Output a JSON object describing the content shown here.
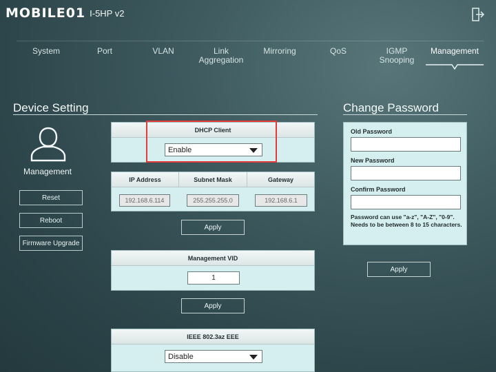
{
  "header": {
    "brand_logo": "MOBILE01",
    "model": "I-5HP v2",
    "logout_icon": "logout-icon"
  },
  "nav": {
    "tabs": [
      {
        "label": "System"
      },
      {
        "label": "Port"
      },
      {
        "label": "VLAN"
      },
      {
        "label": "Link\nAggregation"
      },
      {
        "label": "Mirroring"
      },
      {
        "label": "QoS"
      },
      {
        "label": "IGMP\nSnooping"
      },
      {
        "label": "Management",
        "active": true
      }
    ]
  },
  "device_setting": {
    "title": "Device Setting",
    "sidebar": {
      "icon": "user-icon",
      "label": "Management",
      "buttons": [
        "Reset",
        "Reboot",
        "Firmware Upgrade"
      ]
    },
    "dhcp": {
      "header": "DHCP Client",
      "value": "Enable"
    },
    "ip": {
      "headers": [
        "IP Address",
        "Subnet Mask",
        "Gateway"
      ],
      "values": [
        "192.168.6.114",
        "255.255.255.0",
        "192.168.6.1"
      ],
      "apply": "Apply"
    },
    "vid": {
      "header": "Management VID",
      "value": "1",
      "apply": "Apply"
    },
    "eee": {
      "header": "IEEE 802.3az EEE",
      "value": "Disable"
    }
  },
  "change_password": {
    "title": "Change Password",
    "old_label": "Old Password",
    "new_label": "New Password",
    "confirm_label": "Confirm Password",
    "note": "Password can use \"a-z\", \"A-Z\", \"0-9\". Needs to be between 8 to 15 characters.",
    "apply": "Apply"
  },
  "colors": {
    "highlight": "#e23b3b",
    "panel": "#d5eff0"
  }
}
